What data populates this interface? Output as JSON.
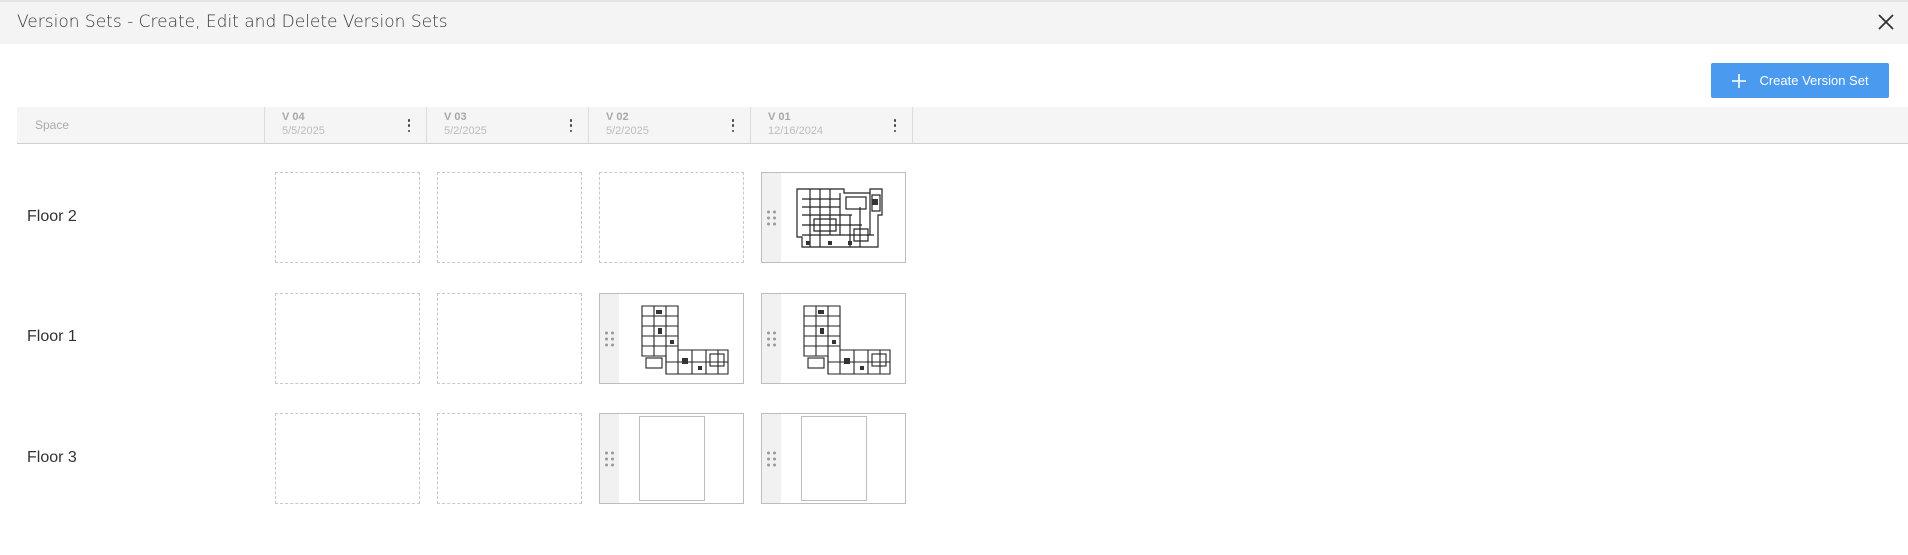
{
  "dialog": {
    "title": "Version Sets - Create, Edit and Delete Version Sets"
  },
  "toolbar": {
    "create_label": "Create Version Set"
  },
  "table": {
    "space_header": "Space",
    "versions": [
      {
        "name": "V 04",
        "date": "5/5/2025"
      },
      {
        "name": "V 03",
        "date": "5/2/2025"
      },
      {
        "name": "V 02",
        "date": "5/2/2025"
      },
      {
        "name": "V 01",
        "date": "12/16/2024"
      }
    ],
    "rows": [
      {
        "space": "Floor 2",
        "cells": [
          "empty",
          "empty",
          "empty",
          "plan-a"
        ]
      },
      {
        "space": "Floor 1",
        "cells": [
          "empty",
          "empty",
          "plan-b",
          "plan-b"
        ]
      },
      {
        "space": "Floor 3",
        "cells": [
          "empty",
          "empty",
          "blank-sheet",
          "blank-sheet"
        ]
      }
    ]
  },
  "icons": {
    "close": "close-icon",
    "plus": "plus-icon",
    "kebab": "more-vertical-icon",
    "drag": "drag-handle-icon"
  },
  "colors": {
    "accent": "#4a9af0",
    "titlebar": "#f4f4f4",
    "header": "#f5f5f5"
  }
}
